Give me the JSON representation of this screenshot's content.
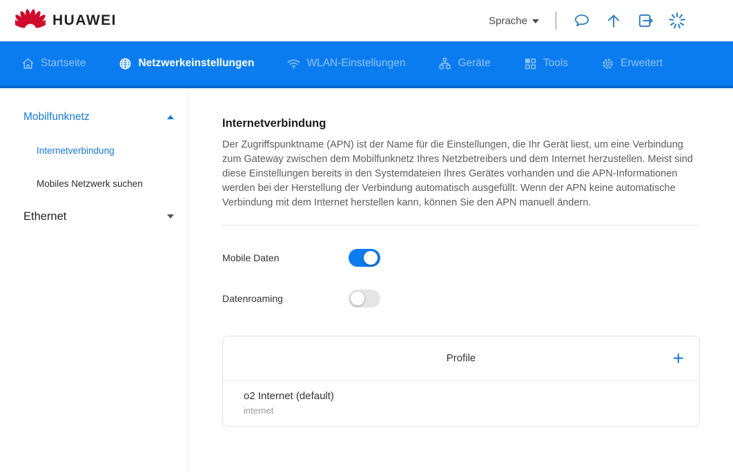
{
  "header": {
    "brand": "HUAWEI",
    "language_label": "Sprache",
    "icons": [
      "chat-icon",
      "upload-arrow-icon",
      "logout-icon",
      "spinner-icon"
    ]
  },
  "nav": {
    "items": [
      {
        "label": "Startseite",
        "icon": "home-icon",
        "active": false
      },
      {
        "label": "Netzwerkeinstellungen",
        "icon": "globe-icon",
        "active": true
      },
      {
        "label": "WLAN-Einstellungen",
        "icon": "wifi-icon",
        "active": false
      },
      {
        "label": "Geräte",
        "icon": "devices-icon",
        "active": false
      },
      {
        "label": "Tools",
        "icon": "tools-grid-icon",
        "active": false
      },
      {
        "label": "Erweitert",
        "icon": "gear-icon",
        "active": false
      }
    ]
  },
  "sidebar": {
    "groups": [
      {
        "label": "Mobilfunknetz",
        "expanded": true,
        "children": [
          {
            "label": "Internetverbindung",
            "active": true
          },
          {
            "label": "Mobiles Netzwerk suchen",
            "active": false
          }
        ]
      },
      {
        "label": "Ethernet",
        "expanded": false,
        "children": []
      }
    ]
  },
  "main": {
    "title": "Internetverbindung",
    "description": "Der Zugriffspunktname (APN) ist der Name für die Einstellungen, die Ihr Gerät liest, um eine Verbindung zum Gateway zwischen dem Mobilfunknetz Ihres Netzbetreibers und dem Internet herzustellen. Meist sind diese Einstellungen bereits in den Systemdateien Ihres Gerätes vorhanden und die APN-Informationen werden bei der Herstellung der Verbindung automatisch ausgefüllt. Wenn der APN keine automatische Verbindung mit dem Internet herstellen kann, können Sie den APN manuell ändern.",
    "toggles": [
      {
        "label": "Mobile Daten",
        "state": "on"
      },
      {
        "label": "Datenroaming",
        "state": "off"
      }
    ],
    "profile_card": {
      "title": "Profile",
      "add_label": "+",
      "items": [
        {
          "name": "o2 Internet (default)",
          "apn": "internet"
        }
      ]
    }
  },
  "colors": {
    "nav_blue": "#0a7cf0",
    "nav_blue_dark": "#0a66cc",
    "huawei_red": "#cf0a2c",
    "link_blue": "#1577d4",
    "toggle_on": "#0a7cf0",
    "toggle_off": "#e5e5e7",
    "header_icon_blue": "#2e80c6"
  }
}
